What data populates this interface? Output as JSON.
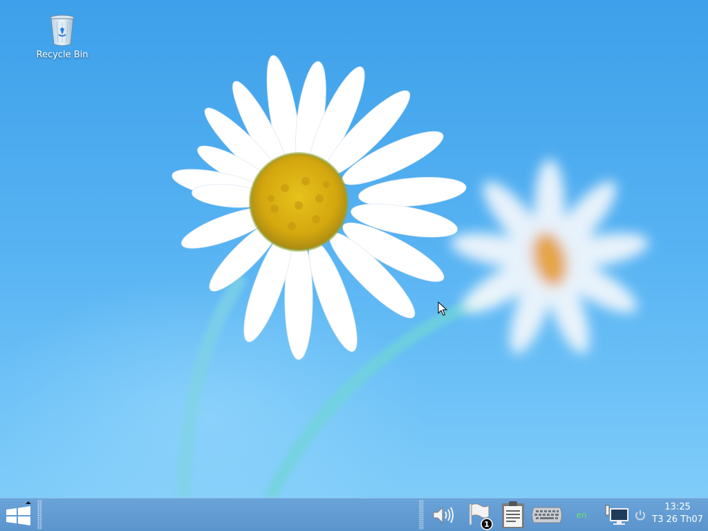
{
  "desktop": {
    "icons": [
      {
        "label": "Recycle Bin",
        "icon": "recycle-bin-icon"
      }
    ]
  },
  "taskbar": {
    "start_icon": "windows-logo-icon",
    "tray": {
      "volume_icon": "speaker-icon",
      "notifications_icon": "flag-icon",
      "notification_count": "1",
      "clipboard_icon": "clipboard-icon",
      "keyboard_icon": "keyboard-icon",
      "language": "en",
      "network_icon": "network-monitor-icon",
      "power_icon": "power-icon"
    },
    "clock": {
      "time": "13:25",
      "date": "T3 26 Th07"
    }
  },
  "colors": {
    "taskbar": "#5b95cd",
    "wallpaper_sky": "#4aa9ef",
    "language_text": "#6ee06e"
  }
}
